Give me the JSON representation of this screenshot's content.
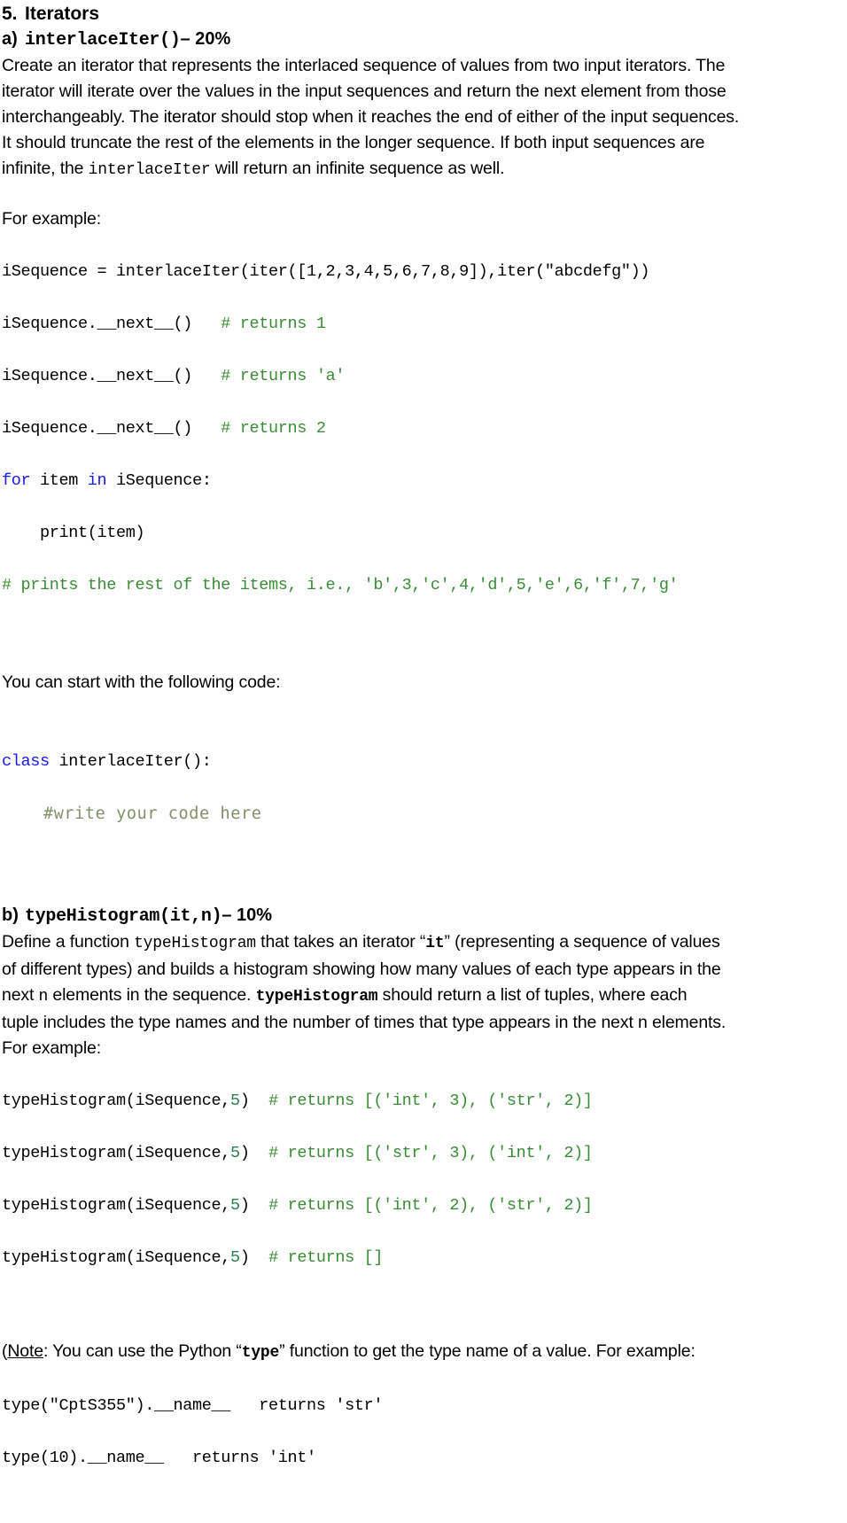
{
  "document": {
    "section": {
      "number": "5.",
      "title": "Iterators"
    },
    "part_a": {
      "label": "a)",
      "signature": "interlaceIter()",
      "weight": "– 20%",
      "paragraph_lines": [
        "Create an iterator that represents the interlaced sequence of values from two input iterators. The",
        "iterator will iterate over the values in the input sequences and return the next element from those",
        "interchangeably.  The iterator should stop when it reaches the end of either of the input sequences.",
        "It should truncate the rest of the elements in the longer sequence. If both input sequences are"
      ],
      "paragraph_last_before": "infinite, the ",
      "paragraph_last_mono": "interlaceIter",
      "paragraph_last_after": " will return an infinite sequence as well.",
      "example_intro": "For example:",
      "code_lines": [
        {
          "plain": "iSequence = interlaceIter(iter([1,2,3,4,5,6,7,8,9]),iter(\"abcdefg\"))"
        },
        {
          "plain": "iSequence.__next__()   ",
          "comment": "# returns 1"
        },
        {
          "plain": "iSequence.__next__()   ",
          "comment": "# returns 'a'"
        },
        {
          "plain": "iSequence.__next__()   ",
          "comment": "# returns 2"
        }
      ],
      "for_line": {
        "kw1": "for",
        "mid": " item ",
        "kw2": "in",
        "tail": " iSequence:"
      },
      "print_line": "    print(item)",
      "prints_comment": "# prints the rest of the items, i.e., 'b',3,'c',4,'d',5,'e',6,'f',7,'g'",
      "starter_intro": "You can start with the following code:",
      "class_line": {
        "kw": "class",
        "rest": " interlaceIter():"
      },
      "write_here": "    #write your code here"
    },
    "part_b": {
      "label": "b)",
      "signature": "typeHistogram(it,n)",
      "weight": "– 10%",
      "desc_line1_a": "Define a function ",
      "desc_line1_mono": "typeHistogram",
      "desc_line1_b": "  that takes an iterator “",
      "desc_line1_mono2": "it",
      "desc_line1_c": "” (representing a sequence of values",
      "desc_line2": "of different types) and builds a histogram showing how many values of each type appears in the",
      "desc_line3_a": "next ",
      "desc_line3_mono": "n",
      "desc_line3_b": "  elements in the sequence. ",
      "desc_line3_mono_b": "typeHistogram",
      "desc_line3_c": " should return a list of tuples, where each",
      "desc_line4": "tuple includes the type names and the number of times that type appears in the next n elements.",
      "example_intro": "For example:",
      "examples": [
        {
          "call_a": "typeHistogram(iSequence,",
          "arg": "5",
          "call_b": ")  ",
          "comment": "# returns [('int', 3), ('str', 2)]"
        },
        {
          "call_a": "typeHistogram(iSequence,",
          "arg": "5",
          "call_b": ")  ",
          "comment": "# returns [('str', 3), ('int', 2)]"
        },
        {
          "call_a": "typeHistogram(iSequence,",
          "arg": "5",
          "call_b": ")  ",
          "comment": "# returns [('int', 2), ('str', 2)]"
        },
        {
          "call_a": "typeHistogram(iSequence,",
          "arg": "5",
          "call_b": ")  ",
          "comment": "# returns []"
        }
      ],
      "note": {
        "open_paren": "(",
        "label": "Note",
        "text_a": ": You can use the Python “",
        "mono": "type",
        "text_b": "” function to get the type name of a value. For example:",
        "code_lines": [
          "type(\"CptS355\").__name__   returns 'str'",
          "type(10).__name__   returns 'int'"
        ]
      }
    }
  },
  "colors": {
    "comment_green": "#3a8c36",
    "keyword_blue": "#1818f0",
    "number_green": "#2f7d52",
    "ghost_green": "#81906d",
    "text_black": "#000000",
    "background": "#ffffff"
  }
}
